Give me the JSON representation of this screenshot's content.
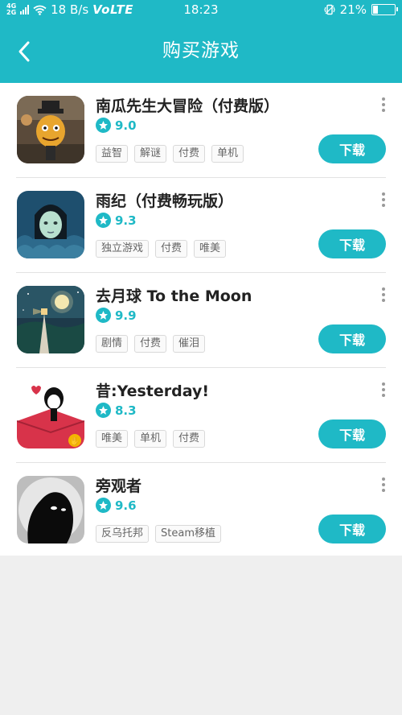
{
  "status_bar": {
    "signal_top": "4G",
    "signal_bottom": "2G",
    "speed": "18 B/s",
    "volte": "VoLTE",
    "time": "18:23",
    "battery": "21%",
    "battery_level": 0.21
  },
  "header": {
    "title": "购买游戏"
  },
  "colors": {
    "accent": "#1fb9c6",
    "background": "#efefef"
  },
  "games": [
    {
      "name": "南瓜先生大冒险（付费版）",
      "rating": "9.0",
      "tags": [
        "益智",
        "解谜",
        "付费",
        "单机"
      ],
      "button": "下载",
      "icon": "pumpkin-man-icon"
    },
    {
      "name": "雨纪（付费畅玩版）",
      "rating": "9.3",
      "tags": [
        "独立游戏",
        "付费",
        "唯美"
      ],
      "button": "下载",
      "icon": "rain-girl-icon"
    },
    {
      "name": "去月球 To the Moon",
      "rating": "9.9",
      "tags": [
        "剧情",
        "付费",
        "催泪"
      ],
      "button": "下载",
      "icon": "moon-lighthouse-icon"
    },
    {
      "name": "昔:Yesterday!",
      "rating": "8.3",
      "tags": [
        "唯美",
        "单机",
        "付费"
      ],
      "button": "下载",
      "icon": "yesterday-girl-icon"
    },
    {
      "name": "旁观者",
      "rating": "9.6",
      "tags": [
        "反乌托邦",
        "Steam移植"
      ],
      "button": "下载",
      "icon": "shadow-figure-icon"
    }
  ]
}
